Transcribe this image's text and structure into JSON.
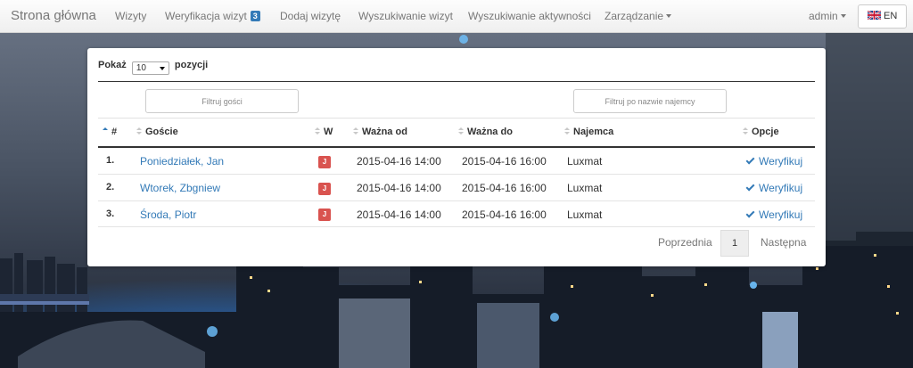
{
  "navbar": {
    "brand": "Strona główna",
    "items": [
      {
        "label": "Wizyty"
      },
      {
        "label": "Weryfikacja wizyt",
        "badge": "3"
      },
      {
        "label": "Dodaj wizytę"
      },
      {
        "label": "Wyszukiwanie wizyt"
      },
      {
        "label": "Wyszukiwanie aktywności"
      },
      {
        "label": "Zarządzanie"
      }
    ],
    "user": "admin",
    "language": "EN",
    "badge_color": "#337ab7"
  },
  "table_controls": {
    "show_label": "Pokaż",
    "page_size": "10",
    "entries_label": "pozycji",
    "filter_guests_placeholder": "Filtruj gości",
    "filter_tenant_placeholder": "Filtruj po nazwie najemcy"
  },
  "table": {
    "columns": [
      "#",
      "Goście",
      "W",
      "Ważna od",
      "Ważna do",
      "Najemca",
      "Opcje"
    ],
    "rows": [
      {
        "num": "1.",
        "guest": "Poniedziałek, Jan",
        "w": "J",
        "from": "2015-04-16 14:00",
        "to": "2015-04-16 16:00",
        "tenant": "Luxmat",
        "action": "Weryfikuj"
      },
      {
        "num": "2.",
        "guest": "Wtorek, Zbgniew",
        "w": "J",
        "from": "2015-04-16 14:00",
        "to": "2015-04-16 16:00",
        "tenant": "Luxmat",
        "action": "Weryfikuj"
      },
      {
        "num": "3.",
        "guest": "Środa, Piotr",
        "w": "J",
        "from": "2015-04-16 14:00",
        "to": "2015-04-16 16:00",
        "tenant": "Luxmat",
        "action": "Weryfikuj"
      }
    ],
    "badge_color": "#d9534f"
  },
  "pagination": {
    "prev": "Poprzednia",
    "current": "1",
    "next": "Następna"
  }
}
